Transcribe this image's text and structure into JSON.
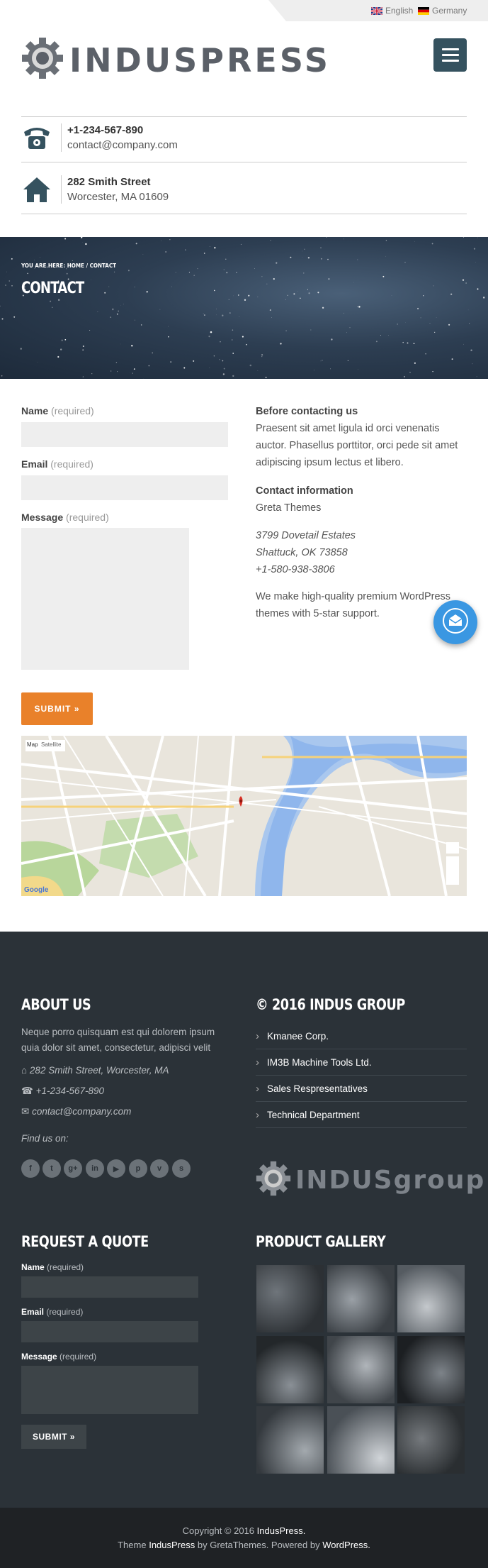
{
  "lang_bar": {
    "english": "English",
    "germany": "Germany"
  },
  "header": {
    "logo_text": "INDUSPRESS",
    "phone": "+1-234-567-890",
    "email": "contact@company.com",
    "street": "282 Smith Street",
    "city": "Worcester, MA 01609"
  },
  "hero": {
    "breadcrumb": "YOU ARE HERE: HOME / CONTACT",
    "title": "CONTACT"
  },
  "form": {
    "name_label": "Name",
    "email_label": "Email",
    "message_label": "Message",
    "required": "(required)",
    "submit": "SUBMIT »"
  },
  "contact_info": {
    "before_heading": "Before contacting us",
    "before_text": "Praesent sit amet ligula id orci venenatis auctor. Phasellus porttitor, orci pede sit amet adipiscing ipsum lectus et libero.",
    "info_heading": "Contact information",
    "company": "Greta Themes",
    "address_line1": "3799 Dovetail Estates",
    "address_line2": "Shattuck, OK 73858",
    "address_phone": "+1-580-938-3806",
    "tagline": "We make high-quality premium WordPress themes with 5-star support."
  },
  "map": {
    "tab_map": "Map",
    "tab_satellite": "Satellite",
    "google": "Google"
  },
  "footer": {
    "about_heading": "ABOUT US",
    "about_text": "Neque porro quisquam est qui dolorem ipsum quia dolor sit amet, consectetur, adipisci velit",
    "address": "282 Smith Street, Worcester, MA",
    "phone": "+1-234-567-890",
    "email": "contact@company.com",
    "find_us": "Find us on:",
    "group_heading": "© 2016 INDUS GROUP",
    "links": [
      "Kmanee Corp.",
      "IM3B Machine Tools Ltd.",
      "Sales Respresentatives",
      "Technical Department"
    ],
    "group_logo": "INDUSgroup",
    "quote_heading": "REQUEST A QUOTE",
    "gallery_heading": "PRODUCT GALLERY",
    "social_icons": [
      "facebook-icon",
      "twitter-icon",
      "google-plus-icon",
      "linkedin-icon",
      "youtube-icon",
      "pinterest-icon",
      "vimeo-icon",
      "skype-icon"
    ]
  },
  "bottom": {
    "copyright_prefix": "Copyright © 2016",
    "copyright_site": "IndusPress.",
    "theme_prefix": "Theme",
    "theme_name": "IndusPress",
    "theme_by": "by GretaThemes. Powered by",
    "powered": "WordPress."
  },
  "colors": {
    "accent": "#e9812a",
    "menu": "#35525f",
    "footer": "#2b3238",
    "chat": "#3a97e2"
  }
}
